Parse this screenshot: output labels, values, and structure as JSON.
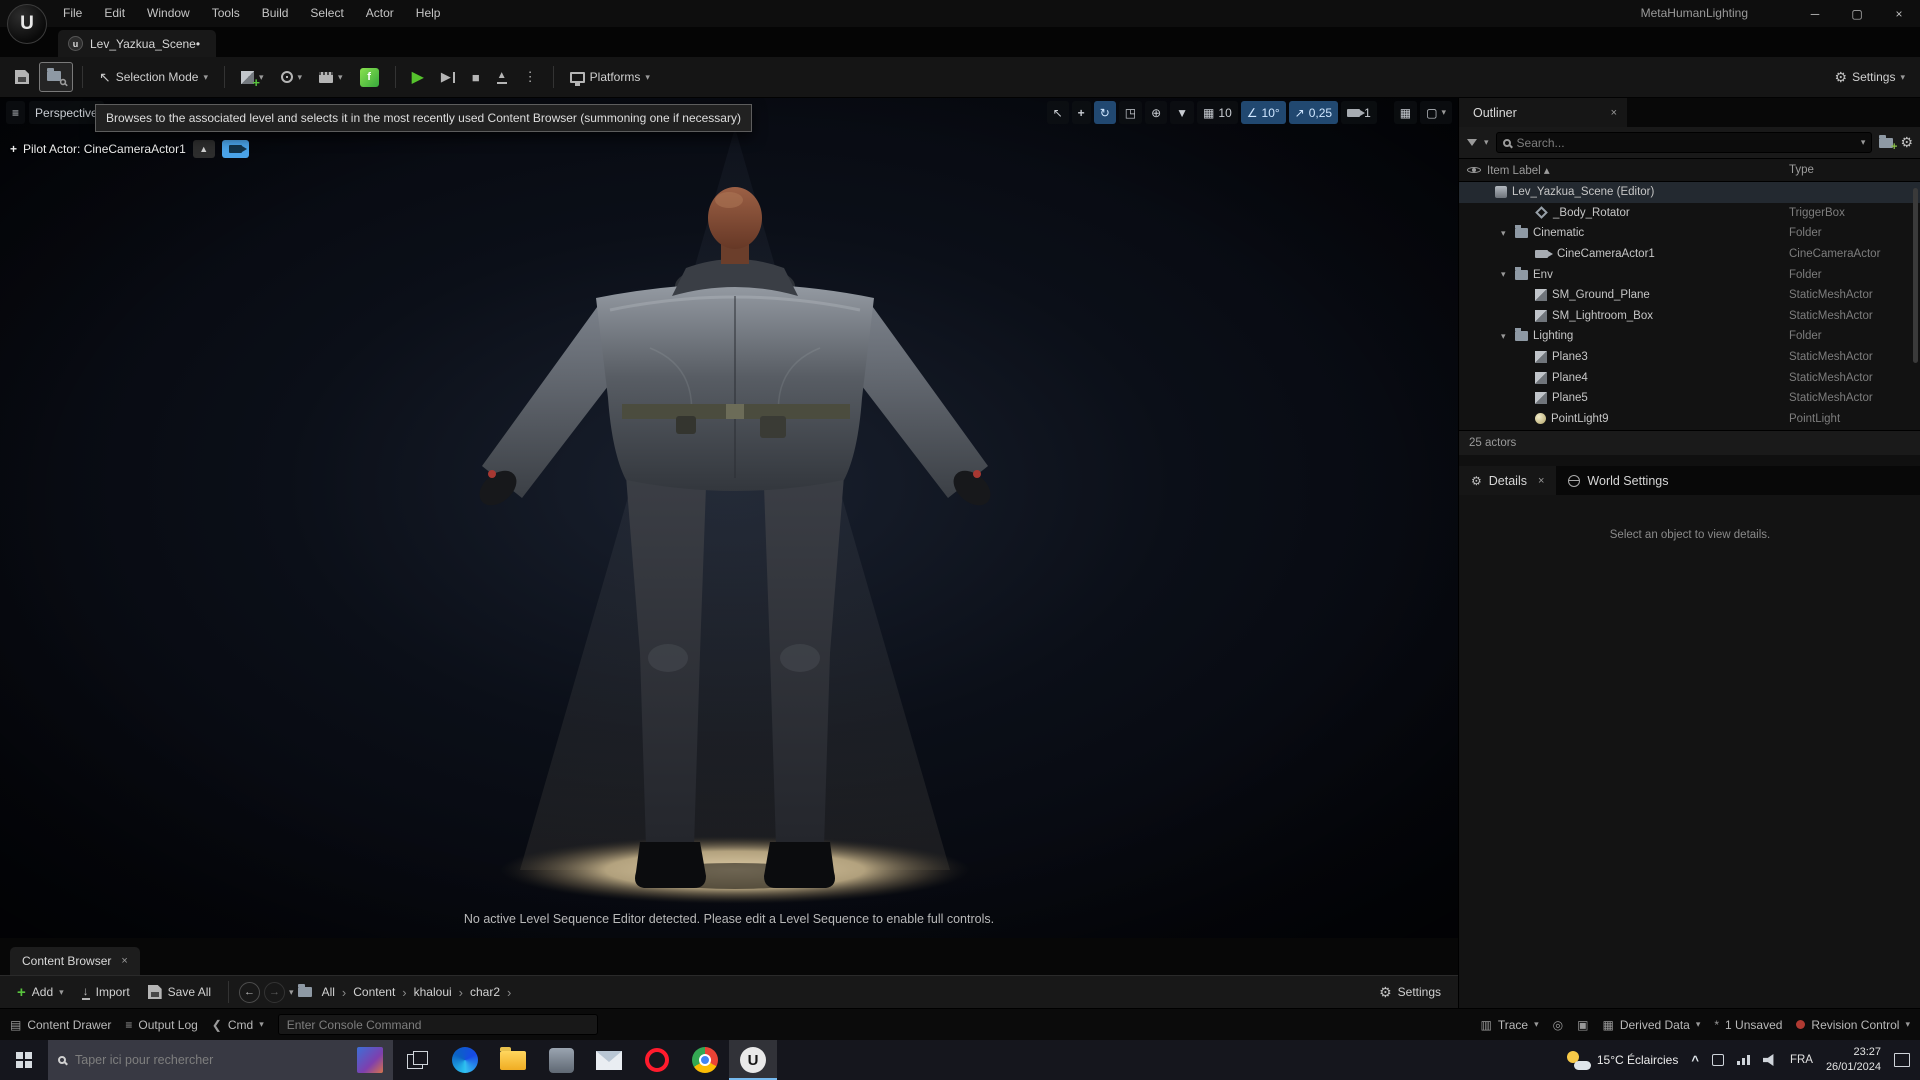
{
  "window": {
    "title": "MetaHumanLighting",
    "menu": [
      "File",
      "Edit",
      "Window",
      "Tools",
      "Build",
      "Select",
      "Actor",
      "Help"
    ]
  },
  "level_tab": "Lev_Yazkua_Scene•",
  "toolbar": {
    "selection_mode": "Selection Mode",
    "platforms": "Platforms",
    "settings": "Settings"
  },
  "tooltip": "Browses to the associated level and selects it in the most recently used Content Browser (summoning one if necessary)",
  "viewport": {
    "perspective": "Perspective",
    "pilot_label": "Pilot Actor: CineCameraActor1",
    "grid_snap_value": "10",
    "angle_snap_value": "10°",
    "scale_snap_value": "0,25",
    "camera_speed_value": "1",
    "message": "No active Level Sequence Editor detected. Please edit a Level Sequence to enable full controls."
  },
  "outliner": {
    "title": "Outliner",
    "search_placeholder": "Search...",
    "columns": {
      "item_label": "Item Label",
      "type": "Type"
    },
    "rows": [
      {
        "label": "Lev_Yazkua_Scene (Editor)",
        "type": "",
        "icon": "level",
        "indent": 1,
        "selected": true
      },
      {
        "label": "_Body_Rotator",
        "type": "TriggerBox",
        "icon": "trigger",
        "indent": 3
      },
      {
        "label": "Cinematic",
        "type": "Folder",
        "icon": "folder",
        "indent": 2,
        "expanded": true
      },
      {
        "label": "CineCameraActor1",
        "type": "CineCameraActor",
        "icon": "camera",
        "indent": 3
      },
      {
        "label": "Env",
        "type": "Folder",
        "icon": "folder",
        "indent": 2,
        "expanded": true
      },
      {
        "label": "SM_Ground_Plane",
        "type": "StaticMeshActor",
        "icon": "mesh",
        "indent": 3
      },
      {
        "label": "SM_Lightroom_Box",
        "type": "StaticMeshActor",
        "icon": "mesh",
        "indent": 3
      },
      {
        "label": "Lighting",
        "type": "Folder",
        "icon": "folder",
        "indent": 2,
        "expanded": true
      },
      {
        "label": "Plane3",
        "type": "StaticMeshActor",
        "icon": "mesh",
        "indent": 3
      },
      {
        "label": "Plane4",
        "type": "StaticMeshActor",
        "icon": "mesh",
        "indent": 3
      },
      {
        "label": "Plane5",
        "type": "StaticMeshActor",
        "icon": "mesh",
        "indent": 3
      },
      {
        "label": "PointLight9",
        "type": "PointLight",
        "icon": "light",
        "indent": 3
      }
    ],
    "footer": "25 actors"
  },
  "details": {
    "tab": "Details",
    "world_settings_tab": "World Settings",
    "empty_message": "Select an object to view details."
  },
  "content_browser": {
    "tab": "Content Browser",
    "add": "Add",
    "import": "Import",
    "save_all": "Save All",
    "breadcrumbs": [
      "All",
      "Content",
      "khaloui",
      "char2"
    ],
    "settings": "Settings"
  },
  "status_bar": {
    "content_drawer": "Content Drawer",
    "output_log": "Output Log",
    "cmd": "Cmd",
    "console_placeholder": "Enter Console Command",
    "trace": "Trace",
    "derived_data": "Derived Data",
    "unsaved": "1 Unsaved",
    "revision_control": "Revision Control"
  },
  "taskbar": {
    "search_placeholder": "Taper ici pour rechercher",
    "weather": "15°C Éclaircies",
    "lang": "FRA",
    "time": "23:27",
    "date": "26/01/2024"
  }
}
